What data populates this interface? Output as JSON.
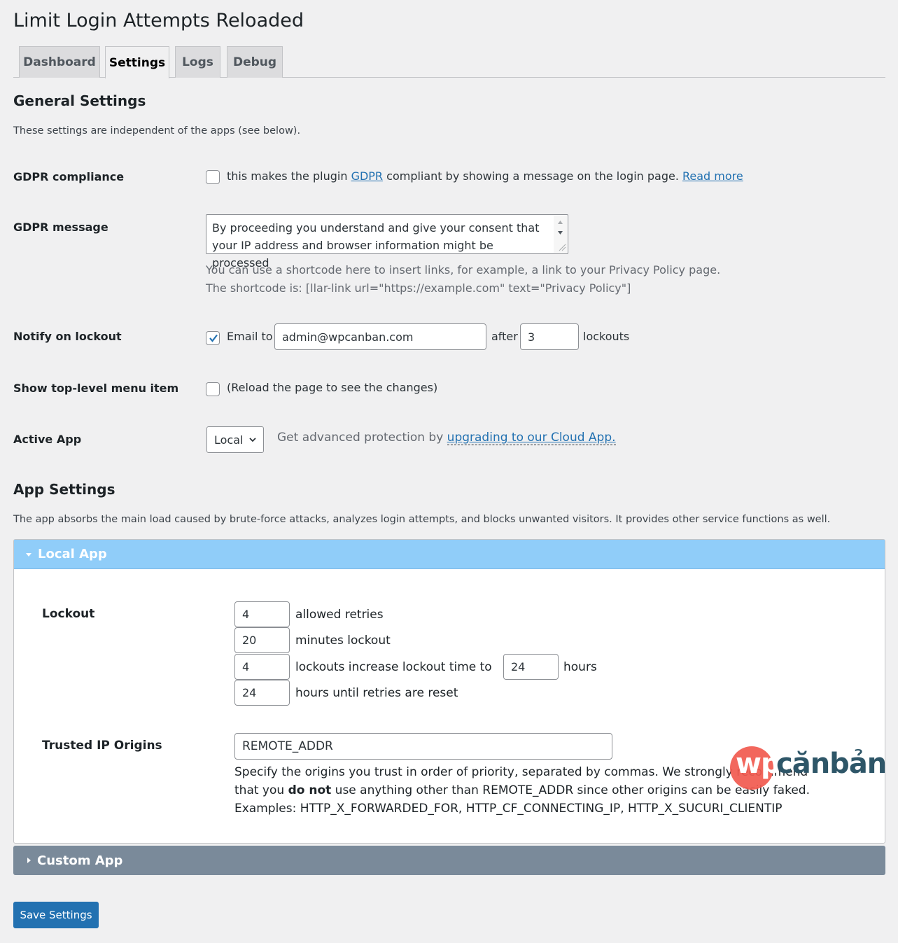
{
  "page": {
    "title": "Limit Login Attempts Reloaded"
  },
  "tabs": [
    {
      "label": "Dashboard",
      "active": false
    },
    {
      "label": "Settings",
      "active": true
    },
    {
      "label": "Logs",
      "active": false
    },
    {
      "label": "Debug",
      "active": false
    }
  ],
  "general": {
    "title": "General Settings",
    "desc": "These settings are independent of the apps (see below)."
  },
  "gdpr_compliance": {
    "label": "GDPR compliance",
    "checked": false,
    "text_before": "this makes the plugin",
    "link_gdpr": "GDPR",
    "text_after": "compliant by showing a message on the login page.",
    "link_read_more": "Read more"
  },
  "gdpr_message": {
    "label": "GDPR message",
    "value_line1": "By proceeding you understand and give your consent that",
    "value_line2": "your IP address and browser information might be processed",
    "help_line1": "You can use a shortcode here to insert links, for example, a link to your Privacy Policy page.",
    "help_line2": "The shortcode is: [llar-link url=\"https://example.com\" text=\"Privacy Policy\"]"
  },
  "notify": {
    "label": "Notify on lockout",
    "checked": true,
    "email_to": "Email to",
    "email": "admin@wpcanban.com",
    "after": "after",
    "count": "3",
    "lockouts": "lockouts"
  },
  "top_menu": {
    "label": "Show top-level menu item",
    "checked": false,
    "note": "(Reload the page to see the changes)"
  },
  "active_app": {
    "label": "Active App",
    "selected": "Local",
    "text": "Get advanced protection by",
    "link": "upgrading to our Cloud App."
  },
  "app_settings": {
    "title": "App Settings",
    "desc": "The app absorbs the main load caused by brute-force attacks, analyzes login attempts, and blocks unwanted visitors. It provides other service functions as well."
  },
  "local_app": {
    "header": "Local App",
    "lockout_label": "Lockout",
    "allowed_retries": "4",
    "allowed_retries_text": "allowed retries",
    "minutes": "20",
    "minutes_text": "minutes lockout",
    "lockouts_count": "4",
    "lockouts_text": "lockouts increase lockout time to",
    "hours_value": "24",
    "hours_text": "hours",
    "reset_hours": "24",
    "reset_text": "hours until retries are reset",
    "trusted_label": "Trusted IP Origins",
    "trusted_value": "REMOTE_ADDR",
    "trusted_help1": "Specify the origins you trust in order of priority, separated by commas. We strongly recommend",
    "trusted_help2_a": "that you",
    "trusted_help2_b": "do not",
    "trusted_help2_c": "use anything other than REMOTE_ADDR since other origins can be easily faked.",
    "trusted_help3": "Examples: HTTP_X_FORWARDED_FOR, HTTP_CF_CONNECTING_IP, HTTP_X_SUCURI_CLIENTIP"
  },
  "custom_app": {
    "header": "Custom App"
  },
  "save": {
    "label": "Save Settings"
  },
  "watermark": {
    "wp": "wp",
    "canban": "cănbản"
  }
}
